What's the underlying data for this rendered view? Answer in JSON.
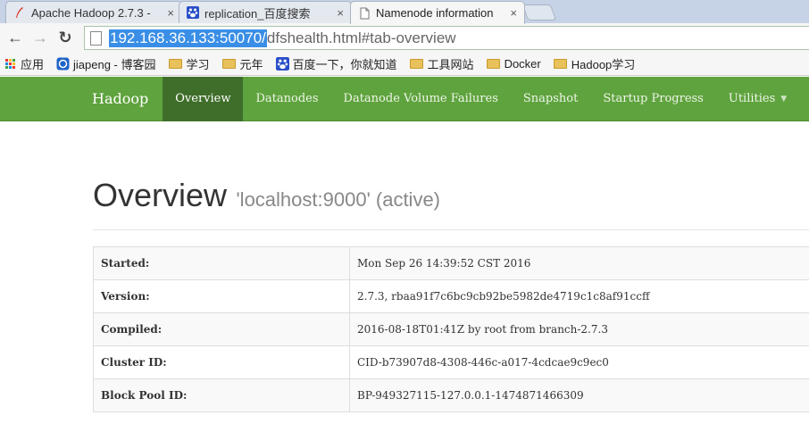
{
  "tabs": [
    {
      "title": "Apache Hadoop 2.7.3 -",
      "close": "×",
      "active": false
    },
    {
      "title": "replication_百度搜索",
      "close": "×",
      "active": false
    },
    {
      "title": "Namenode information",
      "close": "×",
      "active": true
    }
  ],
  "toolbar": {
    "back": "←",
    "forward": "→",
    "reload": "↻",
    "url_host": "192.168.36.133:50070/",
    "url_path": "dfshealth.html#tab-overview"
  },
  "bookmarks": [
    {
      "label": "应用",
      "icon": "apps-icon"
    },
    {
      "label": "jiapeng - 博客园",
      "icon": "site-icon"
    },
    {
      "label": "学习",
      "icon": "folder-icon"
    },
    {
      "label": "元年",
      "icon": "folder-icon"
    },
    {
      "label": "百度一下，你就知道",
      "icon": "baidu-icon"
    },
    {
      "label": "工具网站",
      "icon": "folder-icon"
    },
    {
      "label": "Docker",
      "icon": "folder-icon"
    },
    {
      "label": "Hadoop学习",
      "icon": "folder-icon"
    }
  ],
  "navbar": {
    "brand": "Hadoop",
    "items": [
      "Overview",
      "Datanodes",
      "Datanode Volume Failures",
      "Snapshot",
      "Startup Progress",
      "Utilities"
    ],
    "active": "Overview",
    "color": "#5fa33e",
    "active_color": "#3f6e2a"
  },
  "page": {
    "title": "Overview",
    "subtitle": "'localhost:9000' (active)"
  },
  "info_table": [
    {
      "key": "Started:",
      "value": "Mon Sep 26 14:39:52 CST 2016"
    },
    {
      "key": "Version:",
      "value": "2.7.3, rbaa91f7c6bc9cb92be5982de4719c1c8af91ccff"
    },
    {
      "key": "Compiled:",
      "value": "2016-08-18T01:41Z by root from branch-2.7.3"
    },
    {
      "key": "Cluster ID:",
      "value": "CID-b73907d8-4308-446c-a017-4cdcae9c9ec0"
    },
    {
      "key": "Block Pool ID:",
      "value": "BP-949327115-127.0.0.1-1474871466309"
    }
  ]
}
